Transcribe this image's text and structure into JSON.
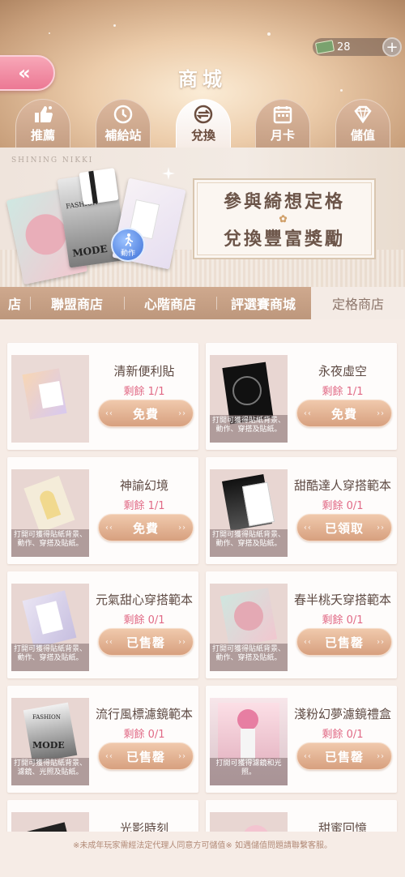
{
  "header": {
    "title": "商城",
    "back_label": "«",
    "currency": {
      "value": "28",
      "plus": "+"
    },
    "tabs": [
      {
        "label": "推薦",
        "icon": "thumbs-up-icon"
      },
      {
        "label": "補給站",
        "icon": "clock-icon"
      },
      {
        "label": "兌換",
        "icon": "exchange-icon"
      },
      {
        "label": "月卡",
        "icon": "calendar-icon"
      },
      {
        "label": "儲值",
        "icon": "diamond-icon"
      }
    ],
    "active_tab": "兌換"
  },
  "banner": {
    "brand": "SHINING NIKKI",
    "line1": "參與綺想定格",
    "line2": "兌換豐富獎勵",
    "badge": "動作"
  },
  "subtabs": [
    {
      "label": "店"
    },
    {
      "label": "聯盟商店"
    },
    {
      "label": "心階商店"
    },
    {
      "label": "評選賽商城"
    },
    {
      "label": "定格商店"
    }
  ],
  "items": [
    {
      "name": "清新便利貼",
      "remain": "剩餘 1/1",
      "button": "免費",
      "caption": ""
    },
    {
      "name": "永夜虛空",
      "remain": "剩餘 1/1",
      "button": "免費",
      "caption": "打開可獲得貼紙背景、動作、穿搭及貼紙。"
    },
    {
      "name": "神諭幻境",
      "remain": "剩餘 1/1",
      "button": "免費",
      "caption": "打開可獲得貼紙背景、動作、穿搭及貼紙。"
    },
    {
      "name": "甜酷達人穿搭範本",
      "remain": "剩餘 0/1",
      "button": "已領取",
      "caption": "打開可獲得貼紙背景、動作、穿搭及貼紙。"
    },
    {
      "name": "元氣甜心穿搭範本",
      "remain": "剩餘 0/1",
      "button": "已售罄",
      "caption": "打開可獲得貼紙背景、動作、穿搭及貼紙。"
    },
    {
      "name": "春半桃夭穿搭範本",
      "remain": "剩餘 0/1",
      "button": "已售罄",
      "caption": "打開可獲得貼紙背景、動作、穿搭及貼紙。"
    },
    {
      "name": "流行風標濾鏡範本",
      "remain": "剩餘 0/1",
      "button": "已售罄",
      "caption": "打開可獲得貼紙背景、濾鏡、光照及貼紙。"
    },
    {
      "name": "淺粉幻夢濾鏡禮盒",
      "remain": "剩餘 0/1",
      "button": "已售罄",
      "caption": "打開可獲得濾鏡和光照。"
    },
    {
      "name": "光影時刻",
      "remain": "",
      "button": "",
      "caption": ""
    },
    {
      "name": "甜蜜回憶",
      "remain": "",
      "button": "",
      "caption": ""
    }
  ],
  "footer": "※未成年玩家需經法定代理人同意方可儲值※ 如遇儲值問題請聯繫客服。"
}
